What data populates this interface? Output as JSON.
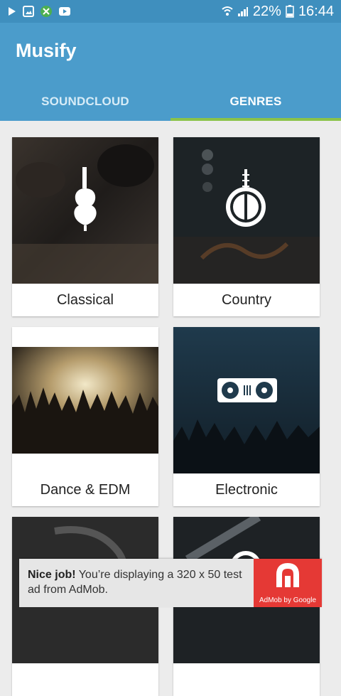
{
  "statusbar": {
    "battery": "22%",
    "time": "16:44"
  },
  "app": {
    "title": "Musify"
  },
  "tabs": [
    {
      "label": "SOUNDCLOUD",
      "active": false
    },
    {
      "label": "GENRES",
      "active": true
    }
  ],
  "genres": [
    {
      "label": "Classical",
      "icon": "violin-icon"
    },
    {
      "label": "Country",
      "icon": "banjo-icon"
    },
    {
      "label": "Dance & EDM",
      "icon": "crowd-photo"
    },
    {
      "label": "Electronic",
      "icon": "turntable-icon"
    },
    {
      "label": "",
      "icon": "guitar-photo"
    },
    {
      "label": "",
      "icon": "banjo-icon"
    }
  ],
  "ad": {
    "headline": "Nice job!",
    "body": " You’re displaying a 320 x 50 test ad from AdMob.",
    "brand": "AdMob by Google"
  },
  "colors": {
    "statusbar": "#3f8fbe",
    "appbar": "#4b9ccb",
    "tab_indicator": "#8bc34a",
    "ad_logo": "#e53935"
  }
}
